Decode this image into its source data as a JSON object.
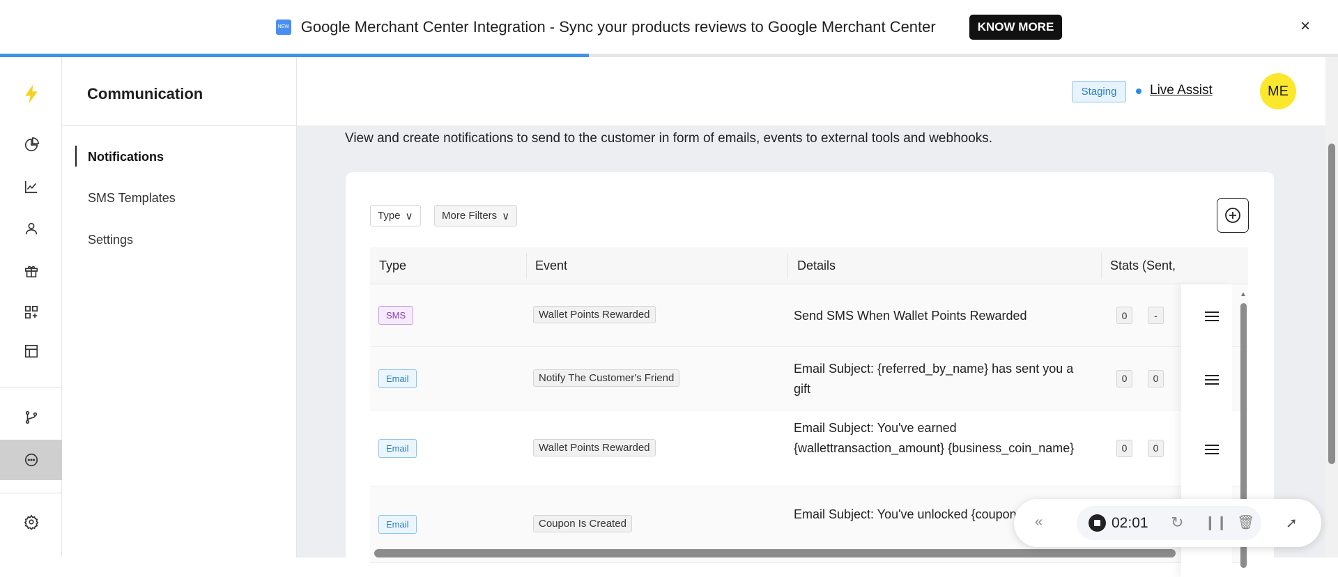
{
  "banner": {
    "new_icon": "NEW",
    "text": "Google Merchant Center Integration - Sync your products reviews to Google Merchant Center",
    "cta": "KNOW MORE",
    "close": "×",
    "progress_percent": 44
  },
  "rail": {
    "items": [
      "logo-bolt",
      "analytics-pie",
      "trend-chart",
      "customers",
      "rewards-gift",
      "widgets",
      "layout",
      "integrations-branch",
      "communication",
      "settings-gear"
    ],
    "active": "communication",
    "accent": "#f4d21e"
  },
  "sidebar": {
    "title": "Communication",
    "items": [
      {
        "label": "Notifications",
        "active": true
      },
      {
        "label": "SMS Templates"
      },
      {
        "label": "Settings"
      }
    ]
  },
  "header": {
    "env_badge": "Staging",
    "live_assist": "Live Assist",
    "avatar": "ME"
  },
  "main": {
    "description": "View and create notifications to send to the customer in form of emails, events to external tools and webhooks.",
    "filters": {
      "type": "Type",
      "more": "More Filters"
    },
    "columns": [
      "Type",
      "Event",
      "Details",
      "Stats (Sent,"
    ],
    "rows": [
      {
        "type": "SMS",
        "event": "Wallet Points Rewarded",
        "details": "Send SMS When Wallet Points Rewarded",
        "stats": [
          "0",
          "-"
        ]
      },
      {
        "type": "Email",
        "event": "Notify The Customer's Friend",
        "details": "Email Subject: {referred_by_name} has sent you a gift",
        "stats": [
          "0",
          "0"
        ]
      },
      {
        "type": "Email",
        "event": "Wallet Points Rewarded",
        "details": "Email Subject: You've earned {wallettransaction_amount} {business_coin_name}",
        "stats": [
          "0",
          "0"
        ]
      },
      {
        "type": "Email",
        "event": "Coupon Is Created",
        "details": "Email Subject: You've unlocked {coupon_name}",
        "stats": []
      }
    ]
  },
  "recorder": {
    "time": "02:01"
  }
}
